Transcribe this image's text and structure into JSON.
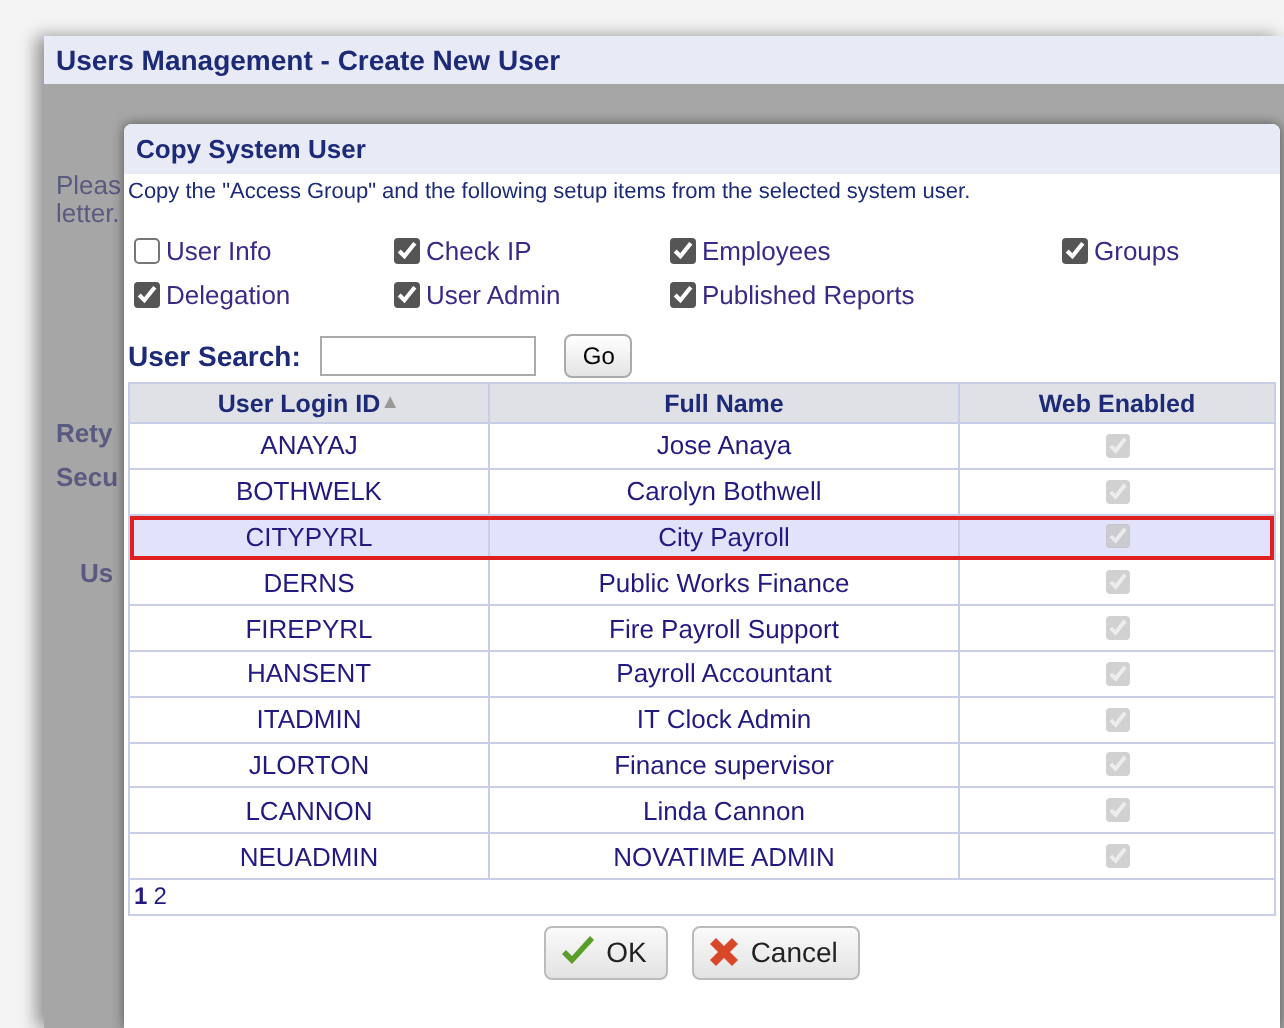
{
  "window": {
    "title": "Users Management - Create New User"
  },
  "background_labels": [
    "Pleas",
    "letter.",
    "Rety",
    "Secu",
    "Us"
  ],
  "dialog": {
    "title": "Copy System User",
    "description": "Copy the \"Access Group\" and the following setup items from the selected system user.",
    "options": [
      {
        "label": "User Info",
        "checked": false
      },
      {
        "label": "Check IP",
        "checked": true
      },
      {
        "label": "Employees",
        "checked": true
      },
      {
        "label": "Groups",
        "checked": true
      },
      {
        "label": "Delegation",
        "checked": true
      },
      {
        "label": "User Admin",
        "checked": true
      },
      {
        "label": "Published Reports",
        "checked": true
      }
    ],
    "search": {
      "label": "User Search:",
      "button": "Go"
    },
    "table": {
      "columns": [
        {
          "label": "User Login ID",
          "sort_icon": "▲"
        },
        {
          "label": "Full Name"
        },
        {
          "label": "Web Enabled"
        }
      ],
      "rows": [
        {
          "login": "ANAYAJ",
          "name": "Jose Anaya",
          "web_enabled": true,
          "selected": false
        },
        {
          "login": "BOTHWELK",
          "name": "Carolyn Bothwell",
          "web_enabled": true,
          "selected": false
        },
        {
          "login": "CITYPYRL",
          "name": "City Payroll",
          "web_enabled": true,
          "selected": true
        },
        {
          "login": "DERNS",
          "name": "Public Works Finance",
          "web_enabled": true,
          "selected": false
        },
        {
          "login": "FIREPYRL",
          "name": "Fire Payroll Support",
          "web_enabled": true,
          "selected": false
        },
        {
          "login": "HANSENT",
          "name": "Payroll Accountant",
          "web_enabled": true,
          "selected": false
        },
        {
          "login": "ITADMIN",
          "name": "IT Clock Admin",
          "web_enabled": true,
          "selected": false
        },
        {
          "login": "JLORTON",
          "name": "Finance supervisor",
          "web_enabled": true,
          "selected": false
        },
        {
          "login": "LCANNON",
          "name": "Linda Cannon",
          "web_enabled": true,
          "selected": false
        },
        {
          "login": "NEUADMIN",
          "name": "NOVATIME ADMIN",
          "web_enabled": true,
          "selected": false
        }
      ],
      "pages": [
        {
          "label": "1",
          "selected": true
        },
        {
          "label": "2",
          "selected": false
        }
      ]
    },
    "buttons": [
      {
        "label": "OK",
        "kind": "ok"
      },
      {
        "label": "Cancel",
        "kind": "cancel"
      }
    ]
  }
}
